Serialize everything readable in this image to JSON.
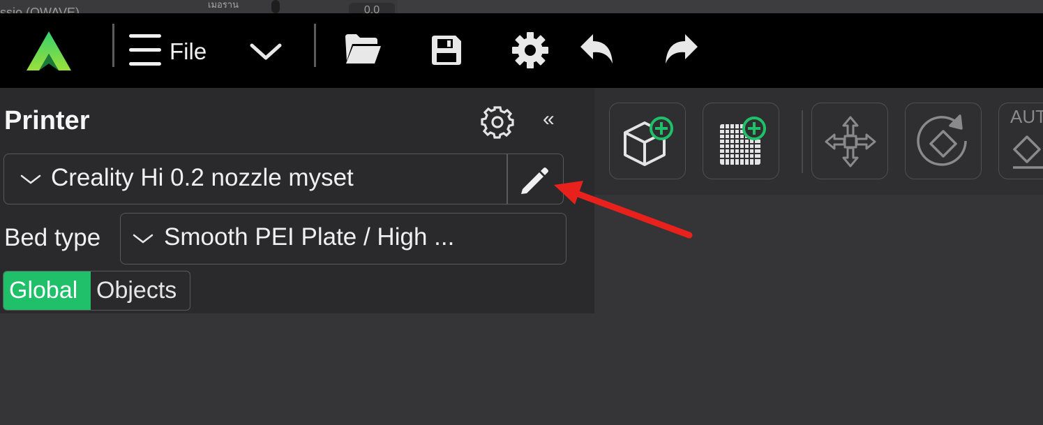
{
  "top_fragment": {
    "left_text": "ssio (QWAVE)",
    "mid_text": "เมอราน",
    "value_text": "0.0"
  },
  "toolbar": {
    "file_label": "File"
  },
  "panel": {
    "title": "Printer",
    "collapse_glyph": "«",
    "printer_preset": "Creality Hi 0.2 nozzle myset",
    "bed_type_label": "Bed type",
    "bed_type_value": "Smooth PEI Plate / High ...",
    "tab_global": "Global",
    "tab_objects": "Objects"
  },
  "right_toolbar": {
    "auto_label": "AUT"
  },
  "colors": {
    "accent_green": "#1fc069",
    "annotation_red": "#e8211c",
    "toolbar_bg": "#000000",
    "panel_bg": "#2a2a2c"
  },
  "icons": [
    "logo-icon",
    "menu-icon",
    "chevron-down-icon",
    "folder-open-icon",
    "save-icon",
    "gear-icon",
    "undo-icon",
    "redo-icon",
    "pencil-icon",
    "add-cube-icon",
    "add-plate-icon",
    "move-icon",
    "rotate-icon",
    "auto-arrange-icon"
  ]
}
